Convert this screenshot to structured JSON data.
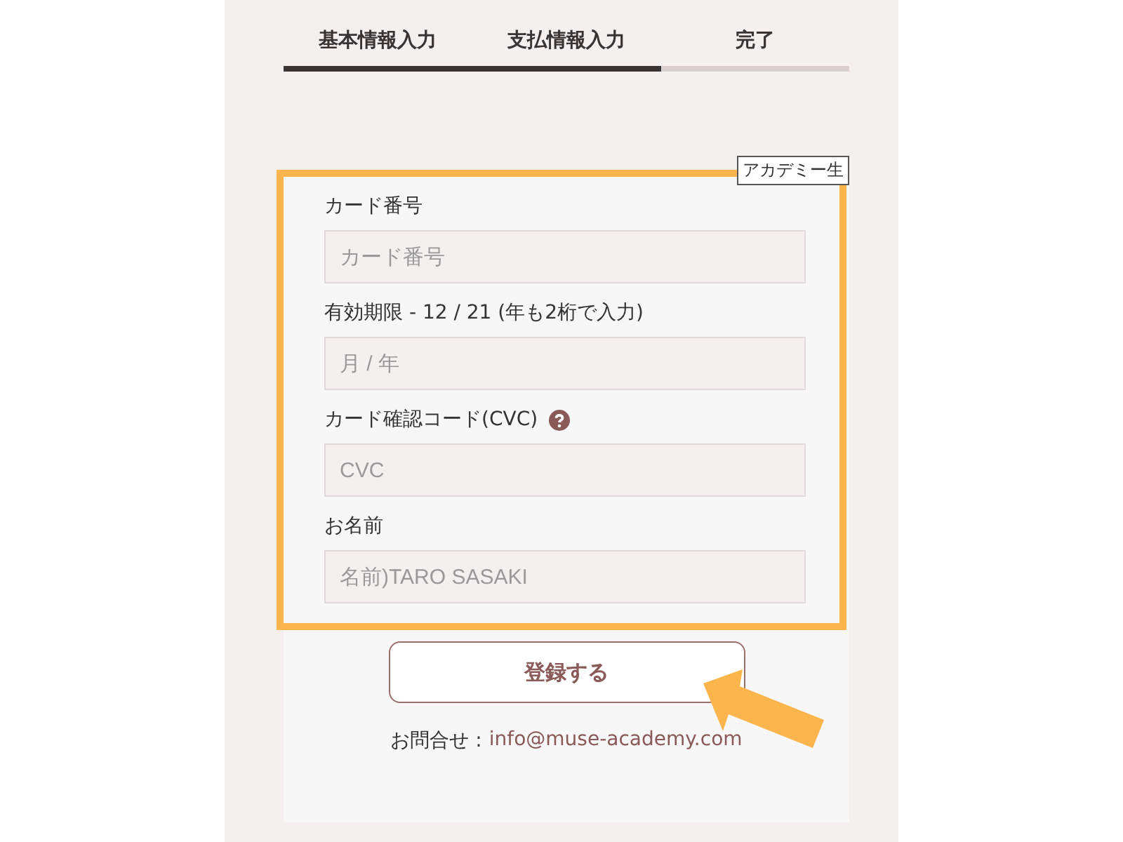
{
  "steps": [
    {
      "label": "基本情報入力",
      "completed": true
    },
    {
      "label": "支払情報入力",
      "completed": true
    },
    {
      "label": "完了",
      "completed": false
    }
  ],
  "badge": "アカデミー生",
  "fields": [
    {
      "label": "カード番号",
      "placeholder": "カード番号",
      "help": false
    },
    {
      "label": "有効期限 - 12 / 21 (年も2桁で入力)",
      "placeholder": "月 / 年",
      "help": false
    },
    {
      "label": "カード確認コード(CVC)",
      "placeholder": "CVC",
      "help": true
    },
    {
      "label": "お名前",
      "placeholder": "名前)TARO SASAKI",
      "help": false
    }
  ],
  "submit_button": "登録する",
  "contact": {
    "label": "お問合せ :",
    "email": "info@muse-academy.com"
  }
}
